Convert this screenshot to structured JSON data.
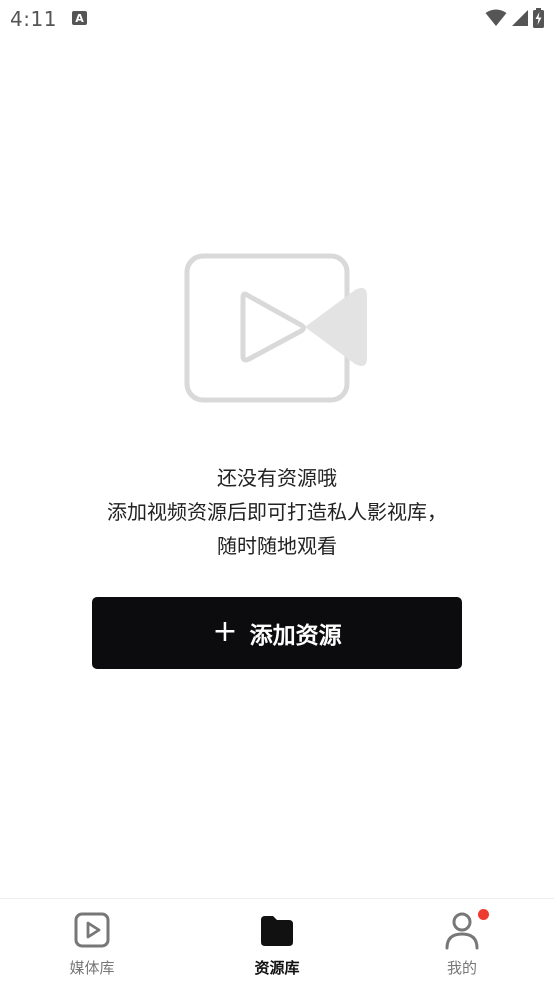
{
  "status_bar": {
    "time": "4:11",
    "notification_icon": "a-badge-icon",
    "icons": [
      "wifi-icon",
      "signal-icon",
      "battery-charging-icon"
    ]
  },
  "empty_state": {
    "illustration_icon": "video-camera-icon",
    "line1": "还没有资源哦",
    "line2": "添加视频资源后即可打造私人影视库，",
    "line3": "随时随地观看"
  },
  "add_button": {
    "icon": "plus-icon",
    "plus": "+",
    "label": "添加资源"
  },
  "bottom_nav": {
    "items": [
      {
        "label": "媒体库",
        "icon": "play-square-icon",
        "active": false
      },
      {
        "label": "资源库",
        "icon": "folder-icon",
        "active": true
      },
      {
        "label": "我的",
        "icon": "user-icon",
        "active": false,
        "badge": true
      }
    ]
  },
  "colors": {
    "button_bg": "#0c0c0e",
    "badge": "#ee3b2f",
    "illustration": "#d9d9d9",
    "nav_inactive": "#777777"
  }
}
